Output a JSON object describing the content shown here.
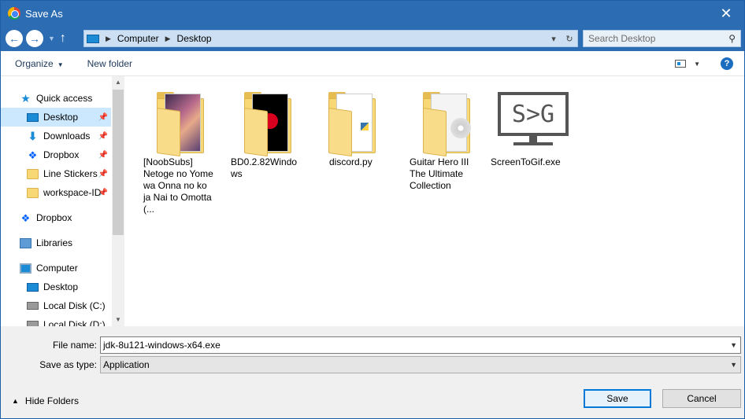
{
  "window": {
    "title": "Save As",
    "close_icon": "close-icon"
  },
  "nav": {
    "back_icon": "back-arrow-icon",
    "forward_icon": "forward-arrow-icon",
    "recent_icon": "chevron-down-icon",
    "up_icon": "up-arrow-icon"
  },
  "address": {
    "crumbs": [
      "Computer",
      "Desktop"
    ],
    "refresh_icon": "refresh-icon"
  },
  "search": {
    "placeholder": "Search Desktop"
  },
  "toolbar": {
    "organize_label": "Organize",
    "new_folder_label": "New folder",
    "help_label": "?"
  },
  "sidebar": {
    "items": [
      {
        "label": "Quick access",
        "icon": "star-icon"
      },
      {
        "label": "Desktop",
        "icon": "desktop-icon",
        "pinned": true,
        "selected": true
      },
      {
        "label": "Downloads",
        "icon": "download-icon",
        "pinned": true
      },
      {
        "label": "Dropbox",
        "icon": "dropbox-icon",
        "pinned": true
      },
      {
        "label": "Line Stickers",
        "icon": "folder-icon",
        "pinned": true
      },
      {
        "label": "workspace-ID",
        "icon": "folder-icon",
        "pinned": true
      },
      {
        "label": "Dropbox",
        "icon": "dropbox-icon"
      },
      {
        "label": "Libraries",
        "icon": "libraries-icon"
      },
      {
        "label": "Computer",
        "icon": "computer-icon"
      },
      {
        "label": "Desktop",
        "icon": "desktop-icon"
      },
      {
        "label": "Local Disk (C:)",
        "icon": "disk-icon"
      },
      {
        "label": "Local Disk (D:)",
        "icon": "disk-icon"
      }
    ]
  },
  "files": [
    {
      "name": "[NoobSubs] Netoge no Yome wa Onna no ko ja Nai to Omotta (...",
      "kind": "folder-anime"
    },
    {
      "name": "BD0.2.82Windows",
      "kind": "folder-discord"
    },
    {
      "name": "discord.py",
      "kind": "folder-python"
    },
    {
      "name": "Guitar Hero III The Ultimate Collection",
      "kind": "folder-disc"
    },
    {
      "name": "ScreenToGif.exe",
      "kind": "exe",
      "logo_text": "S>G"
    }
  ],
  "form": {
    "filename_label": "File name:",
    "filename_value": "jdk-8u121-windows-x64.exe",
    "savetype_label": "Save as type:",
    "savetype_value": "Application",
    "hide_folders_label": "Hide Folders",
    "save_label": "Save",
    "cancel_label": "Cancel"
  },
  "colors": {
    "titlebar": "#2b6cb3",
    "selection": "#cce8ff",
    "primary_button_border": "#0078d7"
  }
}
